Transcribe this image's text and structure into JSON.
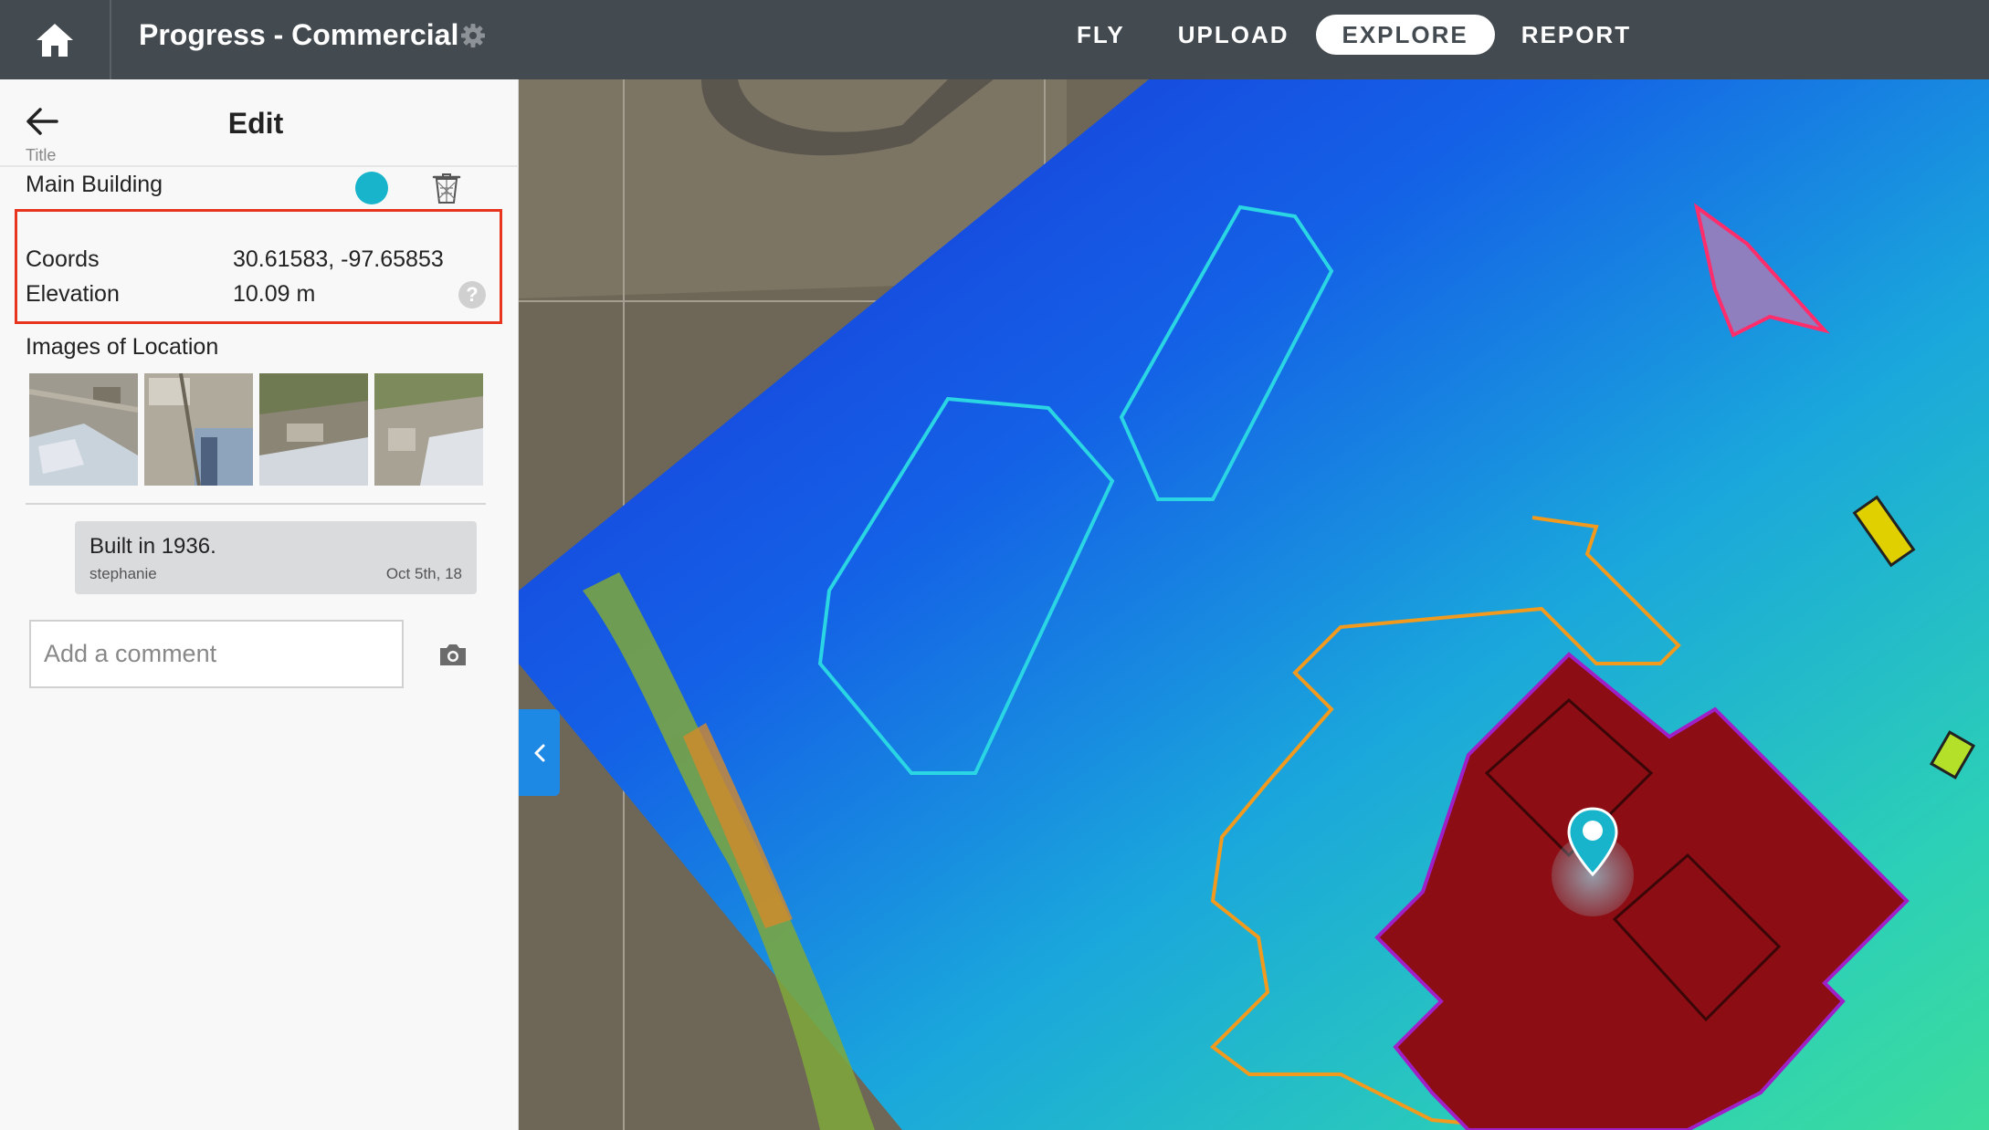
{
  "header": {
    "home_icon": "home-icon",
    "project_title": "Progress - Commercial",
    "settings_icon": "gear-icon",
    "tabs": [
      {
        "label": "FLY",
        "active": false
      },
      {
        "label": "UPLOAD",
        "active": false
      },
      {
        "label": "EXPLORE",
        "active": true
      },
      {
        "label": "REPORT",
        "active": false
      }
    ]
  },
  "panel": {
    "back_icon": "back-arrow-icon",
    "title": "Edit",
    "title_field_label": "Title",
    "title_value": "Main Building",
    "marker_color": "#17b4cb",
    "coords_label": "Coords",
    "coords_value": "30.61583, -97.65853",
    "elevation_label": "Elevation",
    "elevation_value": "10.09 m",
    "help_glyph": "?",
    "images_label": "Images of Location",
    "comment": {
      "text": "Built in 1936.",
      "author": "stephanie",
      "date": "Oct 5th, 18"
    },
    "comment_placeholder": "Add a comment"
  },
  "colors": {
    "topbar": "#434a50",
    "highlight": "#e8351f",
    "accent": "#17b4cb",
    "collapse_tab": "#1e88e5"
  }
}
